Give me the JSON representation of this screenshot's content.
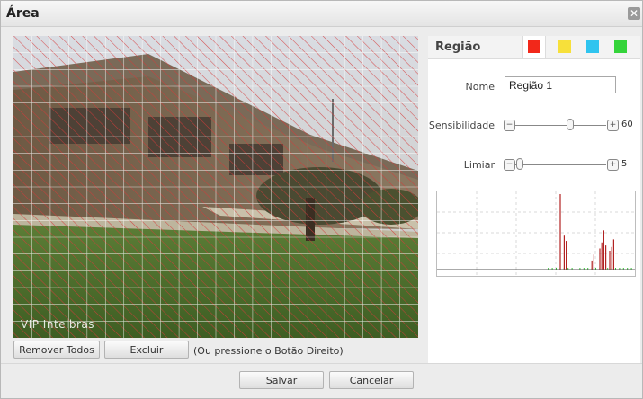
{
  "window": {
    "title": "Área",
    "close_glyph": "✕"
  },
  "video": {
    "watermark": "VIP Intelbras",
    "grid": {
      "columns": 22,
      "rows": 18
    },
    "hatch_color": "#d63a3a",
    "detection_area": "full-frame"
  },
  "controls": {
    "remove_all_label": "Remover Todos",
    "delete_label": "Excluir",
    "hint": "(Ou pressione o Botão Direito)"
  },
  "region_panel": {
    "title": "Região",
    "colors": [
      {
        "name": "red",
        "hex": "#f2281a",
        "selected": true
      },
      {
        "name": "yellow",
        "hex": "#f7e03a",
        "selected": false
      },
      {
        "name": "cyan",
        "hex": "#2fc4ef",
        "selected": false
      },
      {
        "name": "green",
        "hex": "#34d43a",
        "selected": false
      }
    ],
    "name_label": "Nome",
    "name_value": "Região 1",
    "sensitivity_label": "Sensibilidade",
    "sensitivity_value": "60",
    "sensitivity_level": 0.6,
    "threshold_label": "Limiar",
    "threshold_value": "5",
    "threshold_level": 0.05,
    "minus_glyph": "−",
    "plus_glyph": "+",
    "activity_graph": {
      "threshold_line_color": "#2fbf2f",
      "bar_color": "#b22222",
      "bars": [
        0.0,
        0.0,
        0.0,
        0.0,
        0.0,
        0.0,
        0.0,
        0.0,
        0.0,
        0.0,
        0.0,
        0.0,
        0.0,
        0.0,
        0.0,
        0.0,
        0.0,
        0.0,
        0.0,
        0.0,
        0.0,
        0.0,
        0.0,
        0.0,
        0.0,
        0.0,
        0.0,
        0.0,
        0.0,
        0.0,
        0.0,
        0.0,
        0.0,
        0.0,
        0.0,
        0.0,
        0.0,
        0.0,
        0.0,
        0.0,
        0.0,
        0.0,
        0.0,
        0.0,
        0.0,
        0.0,
        0.0,
        0.0,
        0.0,
        0.0,
        0.0,
        0.0,
        0.0,
        0.0,
        0.0,
        0.0,
        0.0,
        0.0,
        0.0,
        0.0,
        0.0,
        0.0,
        1.0,
        0.0,
        0.45,
        0.38,
        0.0,
        0.0,
        0.0,
        0.0,
        0.0,
        0.0,
        0.0,
        0.0,
        0.0,
        0.0,
        0.0,
        0.0,
        0.12,
        0.2,
        0.0,
        0.0,
        0.28,
        0.36,
        0.52,
        0.32,
        0.0,
        0.25,
        0.3,
        0.4,
        0.0,
        0.0,
        0.0,
        0.0,
        0.0,
        0.0,
        0.0,
        0.0,
        0.0,
        0.0
      ]
    }
  },
  "footer": {
    "save_label": "Salvar",
    "cancel_label": "Cancelar"
  }
}
